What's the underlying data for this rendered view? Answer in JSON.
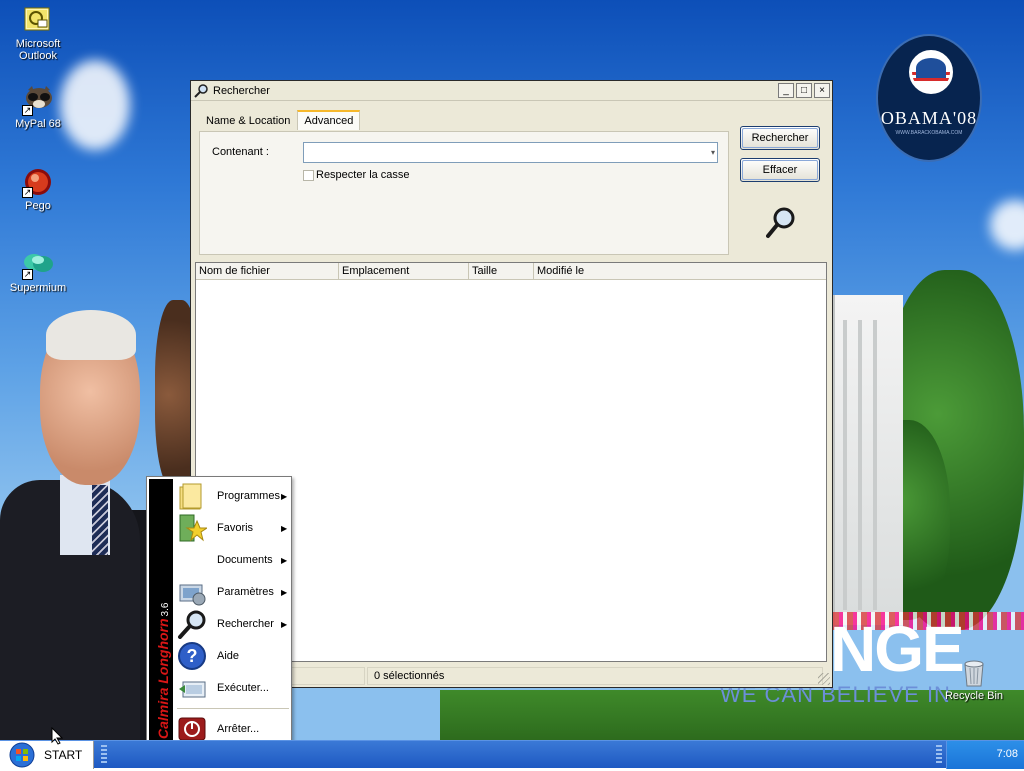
{
  "desktop": {
    "icons": [
      {
        "label": "Microsoft Outlook"
      },
      {
        "label": "MyPal 68"
      },
      {
        "label": "Pego"
      },
      {
        "label": "Supermium"
      },
      {
        "label": "Recycle Bin"
      }
    ],
    "wallpaper": {
      "logo_text": "OBAMA'08",
      "logo_sub": "WWW.BARACKOBAMA.COM",
      "change_text": "NGE",
      "believe_text": "WE CAN BELIEVE IN"
    }
  },
  "window": {
    "title": "Rechercher",
    "controls": {
      "minimize": "_",
      "maximize": "□",
      "close": "×"
    },
    "tabs": [
      {
        "label": "Name & Location",
        "active": false
      },
      {
        "label": "Advanced",
        "active": true
      }
    ],
    "contenant_label": "Contenant :",
    "contenant_value": "",
    "respect_case_label": "Respecter la casse",
    "search_button": "Rechercher",
    "clear_button": "Effacer",
    "columns": [
      "Nom de fichier",
      "Emplacement",
      "Taille",
      "Modifié le"
    ],
    "rows": [],
    "status": {
      "left": "",
      "selected": "0 sélectionnés"
    }
  },
  "start_menu": {
    "side_label": "Calmira Longhorn",
    "side_version": "3.6",
    "items": [
      {
        "label": "Programmes",
        "icon": "folder-icon",
        "submenu": true
      },
      {
        "label": "Favoris",
        "icon": "favorites-star-icon",
        "submenu": true
      },
      {
        "label": "Documents",
        "icon": "documents-icon",
        "submenu": true
      },
      {
        "label": "Paramètres",
        "icon": "settings-icon",
        "submenu": true
      },
      {
        "label": "Rechercher",
        "icon": "magnifier-icon",
        "submenu": true
      },
      {
        "label": "Aide",
        "icon": "help-icon",
        "submenu": false
      },
      {
        "label": "Exécuter...",
        "icon": "run-icon",
        "submenu": false
      },
      {
        "label": "Arrêter...",
        "icon": "shutdown-icon",
        "submenu": false
      }
    ],
    "submenu_arrow": "▶"
  },
  "taskbar": {
    "start_label": "START",
    "clock": "7:08"
  },
  "colors": {
    "taskbar": "#1e59c2",
    "tray": "#1a74d8",
    "window_face": "#ece9d8",
    "active_tab_accent": "#f6b82b",
    "side_text": "#d91616"
  }
}
